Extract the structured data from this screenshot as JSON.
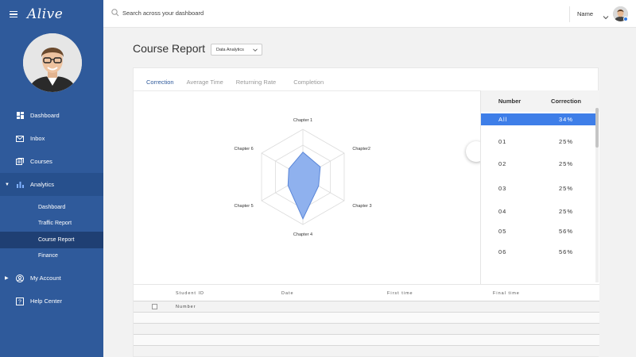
{
  "app": {
    "logo": "Alive"
  },
  "search": {
    "placeholder": "Search across your dashboard"
  },
  "user": {
    "name": "Name"
  },
  "sidebar": {
    "items": [
      {
        "label": "Dashboard",
        "icon": "dashboard-icon"
      },
      {
        "label": "Inbox",
        "icon": "inbox-icon"
      },
      {
        "label": "Courses",
        "icon": "courses-icon"
      },
      {
        "label": "Analytics",
        "icon": "analytics-icon"
      }
    ],
    "sub_items": [
      {
        "label": "Dashboard"
      },
      {
        "label": "Traffic Report"
      },
      {
        "label": "Course Report"
      },
      {
        "label": "Finance"
      }
    ],
    "bottom_items": [
      {
        "label": "My Account",
        "icon": "account-icon"
      },
      {
        "label": "Help Center",
        "icon": "help-icon"
      }
    ]
  },
  "page": {
    "title": "Course Report",
    "select_value": "Data Analytics"
  },
  "tabs": [
    {
      "label": "Correction"
    },
    {
      "label": "Average Time"
    },
    {
      "label": "Returning Rate"
    },
    {
      "label": "Completion"
    }
  ],
  "chart_data": {
    "type": "radar",
    "axes": [
      "Chapter 1",
      "Chapter2",
      "Chapter 3",
      "Chapter 4",
      "Chapter 5",
      "Chapter 6"
    ],
    "values": [
      0.52,
      0.42,
      0.38,
      0.88,
      0.36,
      0.34
    ],
    "rmax": 1,
    "rings": 3,
    "fill_color": "#8fb1ee",
    "stroke_color": "#5a86d8"
  },
  "right_table": {
    "headers": [
      "Number",
      "Correction"
    ],
    "rows": [
      {
        "number": "All",
        "value": "34%"
      },
      {
        "number": "01",
        "value": "25%"
      },
      {
        "number": "02",
        "value": "25%"
      },
      {
        "number": "03",
        "value": "25%"
      },
      {
        "number": "04",
        "value": "25%"
      },
      {
        "number": "05",
        "value": "56%"
      },
      {
        "number": "06",
        "value": "56%"
      }
    ]
  },
  "bottom_table": {
    "headers": [
      "Student ID",
      "Date",
      "First time",
      "Final time"
    ],
    "first_row_label": "Number"
  },
  "colors": {
    "sidebar": "#2f5a9b",
    "accent": "#3e7ee8"
  }
}
